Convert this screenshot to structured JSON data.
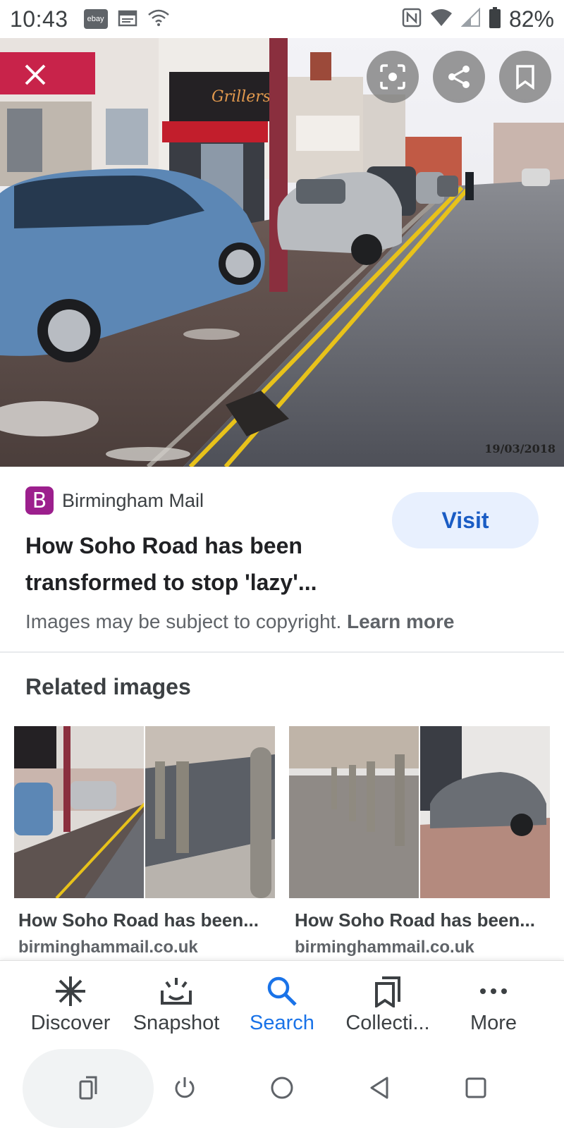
{
  "status_bar": {
    "time": "10:43",
    "ebay_label": "ebay",
    "battery": "82%"
  },
  "hero": {
    "date_stamp": "19/03/2018",
    "shop_sign": "Grillers"
  },
  "result": {
    "source_logo_letter": "B",
    "source_name": "Birmingham Mail",
    "title": "How Soho Road has been transformed to stop 'lazy'...",
    "visit_label": "Visit",
    "copyright_text": "Images may be subject to copyright.",
    "learn_more": "Learn more"
  },
  "related": {
    "heading": "Related images",
    "items": [
      {
        "title": "How Soho Road has been...",
        "source": "birminghammail.co.uk"
      },
      {
        "title": "How Soho Road has been...",
        "source": "birminghammail.co.uk"
      }
    ]
  },
  "bottom_nav": {
    "items": [
      {
        "label": "Discover",
        "icon": "asterisk-icon"
      },
      {
        "label": "Snapshot",
        "icon": "snapshot-icon"
      },
      {
        "label": "Search",
        "icon": "search-icon"
      },
      {
        "label": "Collecti...",
        "icon": "collections-icon"
      },
      {
        "label": "More",
        "icon": "more-icon"
      }
    ],
    "active_color": "#1a73e8"
  },
  "colors": {
    "visit_bg": "#e8f0fe",
    "visit_text": "#1a5cc4",
    "source_logo_bg": "#9c1f8d"
  }
}
